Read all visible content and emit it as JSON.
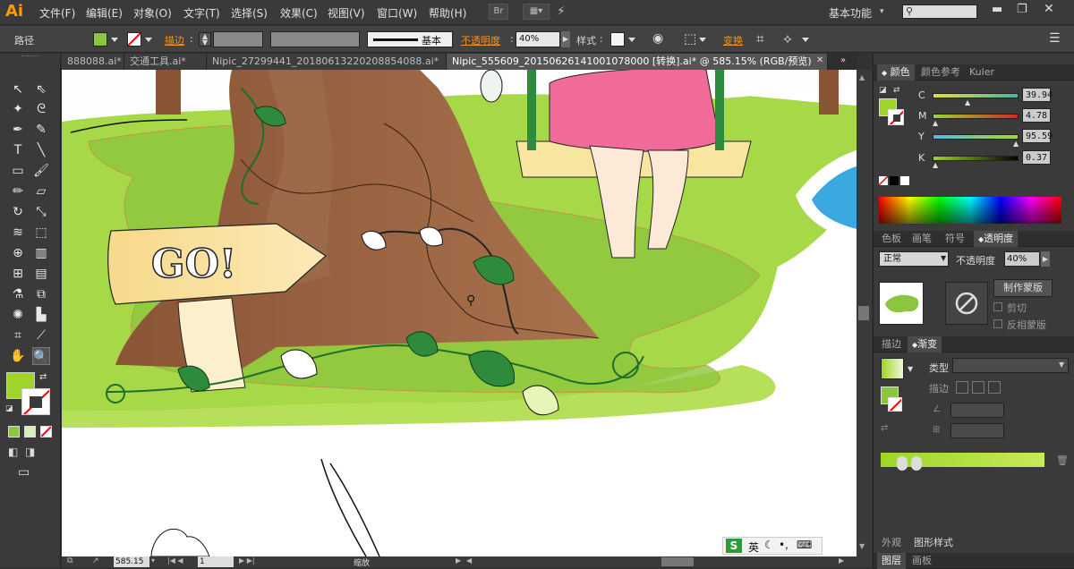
{
  "app": {
    "logo": "Ai"
  },
  "menu": [
    "文件(F)",
    "编辑(E)",
    "对象(O)",
    "文字(T)",
    "选择(S)",
    "效果(C)",
    "视图(V)",
    "窗口(W)",
    "帮助(H)"
  ],
  "menubar": {
    "br_label": "Br",
    "workspace": "基本功能",
    "search_placeholder": ""
  },
  "control": {
    "path_label": "路径",
    "fill_color": "#8cc63f",
    "stroke_label": "描边",
    "brush_label": "基本",
    "opacity_label": "不透明度",
    "opacity_value": "40%",
    "style_label": "样式",
    "transform_label": "变换"
  },
  "tabs": [
    {
      "label": "888088.ai*"
    },
    {
      "label": "交通工具.ai*"
    },
    {
      "label": "Nipic_27299441_20180613220208854088.ai*"
    },
    {
      "label": "Nipic_555609_20150626141001078000 [转换].ai* @ 585.15% (RGB/预览)"
    }
  ],
  "status": {
    "zoom": "585.15",
    "page": "1",
    "tool_name": "缩放"
  },
  "color_panel": {
    "tabs": [
      "颜色",
      "颜色参考",
      "Kuler"
    ],
    "channels": [
      {
        "name": "C",
        "value": "39.94"
      },
      {
        "name": "M",
        "value": "4.78"
      },
      {
        "name": "Y",
        "value": "95.59"
      },
      {
        "name": "K",
        "value": "0.37"
      }
    ],
    "fill_color": "#9fd52a"
  },
  "transparency_panel": {
    "tabs": [
      "色板",
      "画笔",
      "符号",
      "透明度"
    ],
    "blend_mode": "正常",
    "opacity_label": "不透明度",
    "opacity_value": "40%",
    "make_mask": "制作蒙版",
    "clip": "剪切",
    "invert": "反相蒙版"
  },
  "gradient_panel": {
    "tabs": [
      "描边",
      "渐变"
    ],
    "type_label": "类型",
    "type_value": "",
    "stroke_label": "描边"
  },
  "bottom_panels": {
    "appearance": "外观",
    "graphic_styles": "图形样式",
    "layers": "图层",
    "artboards": "画板"
  },
  "ime": {
    "lang": "英"
  }
}
